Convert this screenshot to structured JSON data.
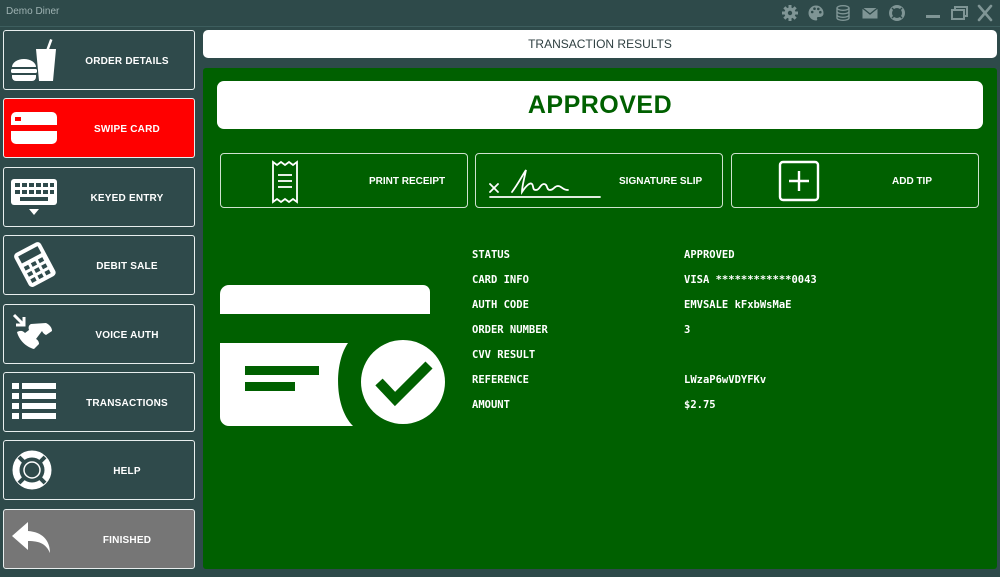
{
  "window": {
    "title": "Demo Diner",
    "toolbar_icons": [
      "gear-icon",
      "palette-icon",
      "database-icon",
      "mail-icon",
      "lifebuoy-icon"
    ],
    "controls": [
      "minimize-icon",
      "restore-icon",
      "close-icon"
    ]
  },
  "sidebar": {
    "items": [
      {
        "label": "ORDER DETAILS",
        "icon": "burger-drink-icon"
      },
      {
        "label": "SWIPE CARD",
        "icon": "card-icon"
      },
      {
        "label": "KEYED ENTRY",
        "icon": "keyboard-icon"
      },
      {
        "label": "DEBIT SALE",
        "icon": "pinpad-icon"
      },
      {
        "label": "VOICE AUTH",
        "icon": "phone-icon"
      },
      {
        "label": "TRANSACTIONS",
        "icon": "list-icon"
      },
      {
        "label": "HELP",
        "icon": "lifebuoy-icon"
      },
      {
        "label": "FINISHED",
        "icon": "return-arrow-icon"
      }
    ],
    "active_color": "#ff0000",
    "finished_color": "#767676"
  },
  "header": {
    "title": "TRANSACTION RESULTS"
  },
  "result": {
    "banner": "APPROVED",
    "panel_color": "#006000",
    "actions": [
      {
        "label": "PRINT RECEIPT",
        "icon": "receipt-icon"
      },
      {
        "label": "SIGNATURE SLIP",
        "icon": "signature-icon"
      },
      {
        "label": "ADD TIP",
        "icon": "plus-box-icon"
      }
    ],
    "details": [
      {
        "key": "STATUS",
        "value": "APPROVED"
      },
      {
        "key": "CARD INFO",
        "value": "VISA ************0043"
      },
      {
        "key": "AUTH CODE",
        "value": "EMVSALE kFxbWsMaE"
      },
      {
        "key": "ORDER NUMBER",
        "value": "3"
      },
      {
        "key": "CVV RESULT",
        "value": ""
      },
      {
        "key": "REFERENCE",
        "value": "LWzaP6wVDYFKv"
      },
      {
        "key": "AMOUNT",
        "value": "$2.75"
      }
    ]
  }
}
